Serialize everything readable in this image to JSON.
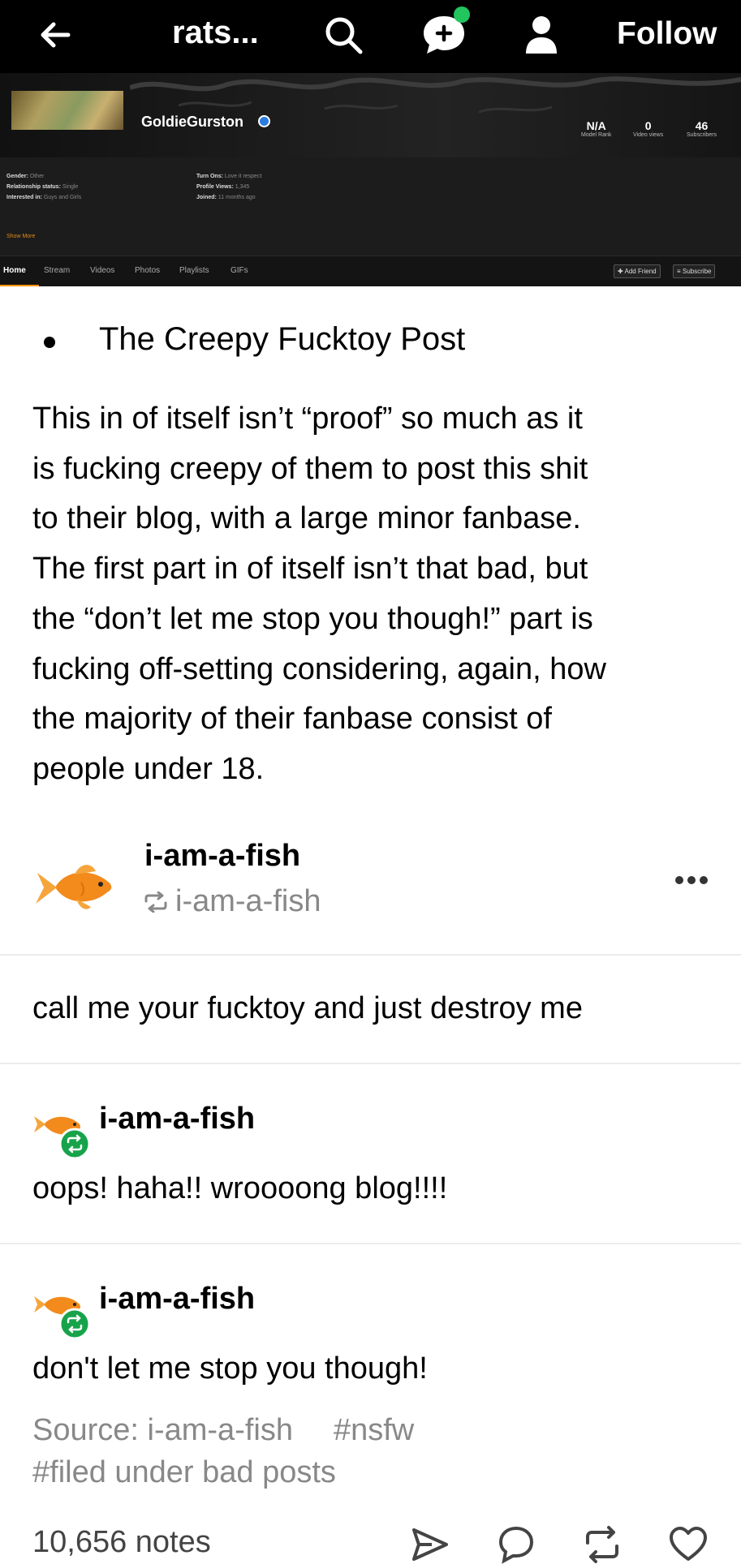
{
  "topbar": {
    "title": "rats...",
    "follow_label": "Follow",
    "icons": [
      "back-arrow-icon",
      "search-icon",
      "new-message-icon",
      "account-icon"
    ],
    "badge_color": "#22c55e"
  },
  "profile": {
    "name": "GoldieGurston",
    "stats": [
      {
        "value": "N/A",
        "label": "Model Rank"
      },
      {
        "value": "0",
        "label": "Video views"
      },
      {
        "value": "46",
        "label": "Subscribers"
      }
    ],
    "info_left": [
      {
        "key": "Gender:",
        "value": "Other"
      },
      {
        "key": "Relationship status:",
        "value": "Single"
      },
      {
        "key": "Interested in:",
        "value": "Guys and Girls"
      }
    ],
    "info_right": [
      {
        "key": "Turn Ons:",
        "value": "Love it respect"
      },
      {
        "key": "Profile Views:",
        "value": "1,345"
      },
      {
        "key": "Joined:",
        "value": "11 months ago"
      }
    ],
    "show_more": "Show More",
    "tabs": [
      "Home",
      "Stream",
      "Videos",
      "Photos",
      "Playlists",
      "GIFs"
    ],
    "buttons": [
      "Add Friend",
      "Subscribe"
    ],
    "accent": "#ff9000"
  },
  "post": {
    "heading": "The Creepy Fucktoy Post",
    "paragraph_lines": [
      "This in of itself  isn’t “proof” so much as it",
      "is fucking creepy of them to post this shit",
      "to their blog, with a large minor fanbase.",
      "The first part in of itself  isn’t that bad, but",
      "the “don’t let me stop you though!” part is",
      "fucking  off-setting considering, again, how",
      "the majority of their fanbase  consist of",
      "people under 18."
    ]
  },
  "reblog": {
    "username": "i-am-a-fish",
    "reblogged_from": "i-am-a-fish",
    "first_text": "call me your fucktoy and just destroy me",
    "replies": [
      {
        "user": "i-am-a-fish",
        "text": "oops! haha!! wroooong blog!!!!"
      },
      {
        "user": "i-am-a-fish",
        "text": "don't let me stop you though!"
      }
    ],
    "source": "Source: i-am-a-fish",
    "tags": [
      "#nsfw",
      "#filed under bad posts"
    ],
    "notes": "10,656 notes",
    "action_icons": [
      "share-icon",
      "reply-icon",
      "reblog-icon",
      "like-icon"
    ]
  }
}
